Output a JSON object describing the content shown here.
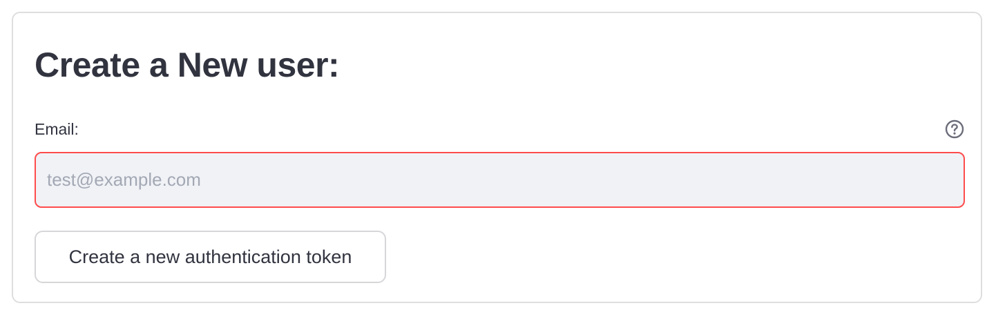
{
  "form": {
    "title": "Create a New user:",
    "email_label": "Email:",
    "email_placeholder": "test@example.com",
    "email_value": "",
    "help_icon": "question-circle-icon",
    "submit_label": "Create a new authentication token"
  },
  "colors": {
    "error_border": "#ff4b4b",
    "input_background": "#f0f2f6",
    "text": "#31333f"
  }
}
